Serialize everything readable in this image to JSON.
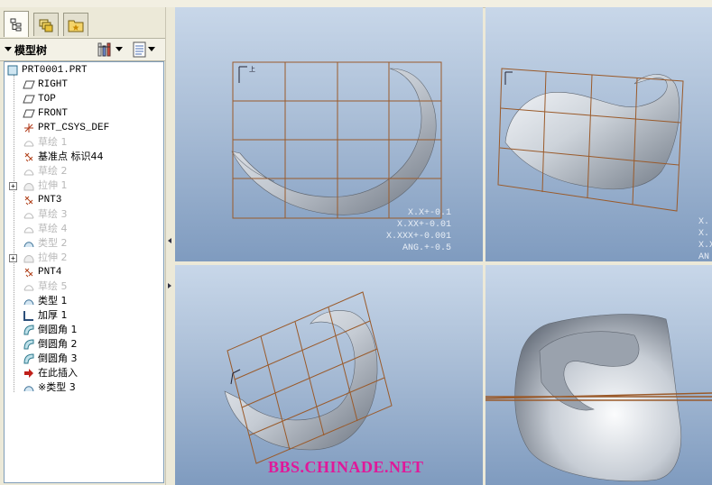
{
  "panel": {
    "title": "模型树",
    "tabs": [
      "model-tree-tab",
      "layers-tab",
      "favorites-tab"
    ]
  },
  "tree": {
    "items": [
      {
        "label": "PRT0001.PRT",
        "icon": "part-icon",
        "state": "active",
        "expandable": false
      },
      {
        "label": "RIGHT",
        "icon": "datum-plane-icon",
        "state": "active",
        "expandable": false
      },
      {
        "label": "TOP",
        "icon": "datum-plane-icon",
        "state": "active",
        "expandable": false
      },
      {
        "label": "FRONT",
        "icon": "datum-plane-icon",
        "state": "active",
        "expandable": false
      },
      {
        "label": "PRT_CSYS_DEF",
        "icon": "coordinate-system-icon",
        "state": "active",
        "expandable": false
      },
      {
        "label": "草绘 1",
        "icon": "sketch-icon",
        "state": "suppressed",
        "expandable": false
      },
      {
        "label": "基准点 标识44",
        "icon": "datum-point-icon",
        "state": "active",
        "expandable": false
      },
      {
        "label": "草绘 2",
        "icon": "sketch-icon",
        "state": "suppressed",
        "expandable": false
      },
      {
        "label": "拉伸 1",
        "icon": "extrude-icon",
        "state": "suppressed",
        "expandable": true
      },
      {
        "label": "PNT3",
        "icon": "datum-point-icon",
        "state": "active",
        "expandable": false
      },
      {
        "label": "草绘 3",
        "icon": "sketch-icon",
        "state": "suppressed",
        "expandable": false
      },
      {
        "label": "草绘 4",
        "icon": "sketch-icon",
        "state": "suppressed",
        "expandable": false
      },
      {
        "label": "类型 2",
        "icon": "surface-icon",
        "state": "suppressed",
        "expandable": false
      },
      {
        "label": "拉伸 2",
        "icon": "extrude-icon",
        "state": "suppressed",
        "expandable": true
      },
      {
        "label": "PNT4",
        "icon": "datum-point-icon",
        "state": "active",
        "expandable": false
      },
      {
        "label": "草绘 5",
        "icon": "sketch-icon",
        "state": "suppressed",
        "expandable": false
      },
      {
        "label": "类型 1",
        "icon": "surface-icon",
        "state": "active",
        "expandable": false
      },
      {
        "label": "加厚 1",
        "icon": "thicken-icon",
        "state": "active",
        "expandable": false
      },
      {
        "label": "倒圆角 1",
        "icon": "round-icon",
        "state": "active",
        "expandable": false
      },
      {
        "label": "倒圆角 2",
        "icon": "round-icon",
        "state": "active",
        "expandable": false
      },
      {
        "label": "倒圆角 3",
        "icon": "round-icon",
        "state": "active",
        "expandable": false
      },
      {
        "label": "在此插入",
        "icon": "insert-here-arrow-icon",
        "state": "active",
        "expandable": false
      },
      {
        "label": "※类型 3",
        "icon": "surface-icon",
        "state": "active",
        "expandable": false
      }
    ]
  },
  "viewports": {
    "tolerances": "X.X+-0.1\nX.XX+-0.01\nX.XXX+-0.001\nANG.+-0.5",
    "tolerances_partial": "X.\nX.\nX.X\nAN",
    "csys_label": "上"
  },
  "watermark": "BBS.CHINADE.NET",
  "colors": {
    "grid": "#9a5a2a",
    "viewport_top": "#c8d7e9",
    "viewport_bottom": "#7f9bbf",
    "tree_border": "#7f9db9",
    "watermark": "#e0189a"
  }
}
